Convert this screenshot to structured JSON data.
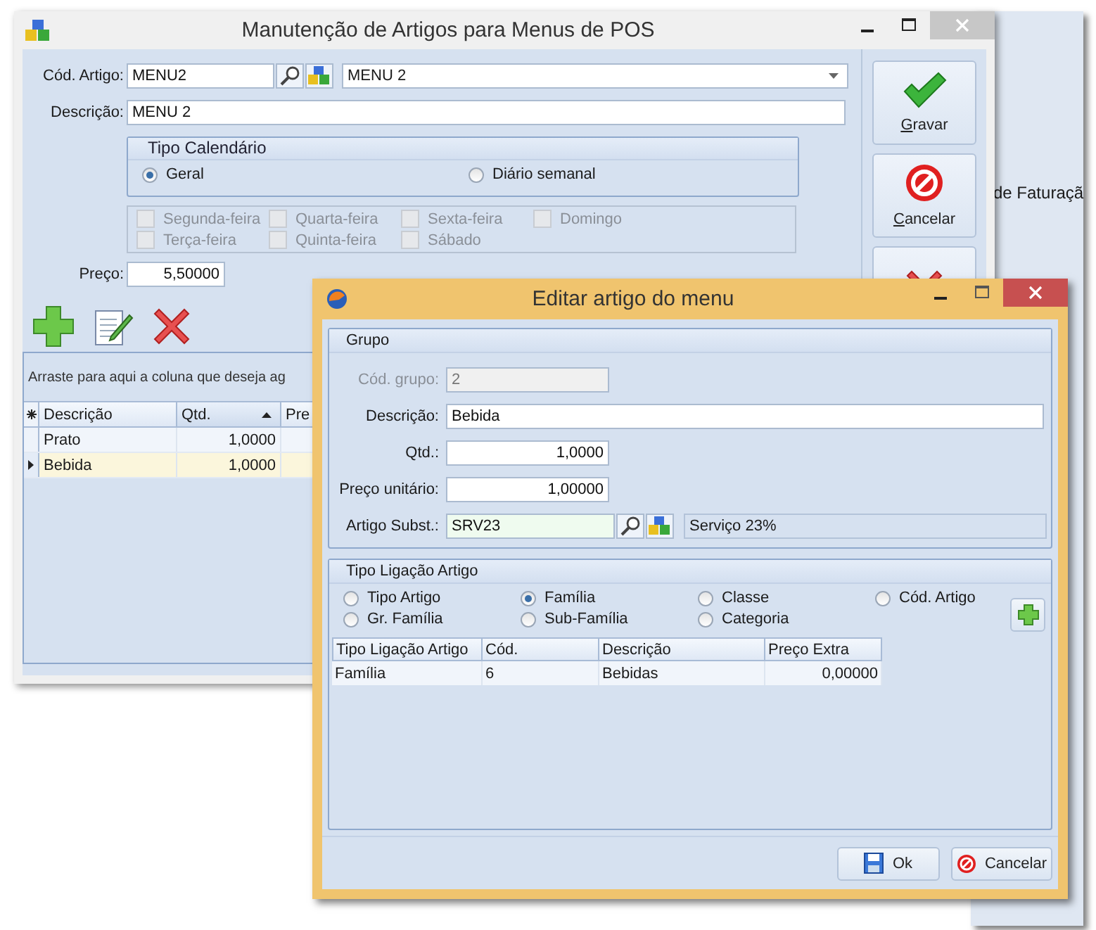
{
  "background_window": {
    "text": "de Faturaçã"
  },
  "main_window": {
    "title": "Manutenção de Artigos para Menus de POS",
    "cod_artigo": {
      "label": "Cód. Artigo:",
      "value": "MENU2",
      "name_value": "MENU 2"
    },
    "descricao": {
      "label": "Descrição:",
      "value": "MENU 2"
    },
    "tipo_calendario": {
      "title": "Tipo Calendário",
      "options": [
        {
          "label": "Geral",
          "selected": true
        },
        {
          "label": "Diário semanal",
          "selected": false
        }
      ]
    },
    "weekdays": [
      {
        "label": "Segunda-feira",
        "checked": false,
        "disabled": true
      },
      {
        "label": "Quarta-feira",
        "checked": false,
        "disabled": true
      },
      {
        "label": "Sexta-feira",
        "checked": false,
        "disabled": true
      },
      {
        "label": "Domingo",
        "checked": false,
        "disabled": true
      },
      {
        "label": "Terça-feira",
        "checked": false,
        "disabled": true
      },
      {
        "label": "Quinta-feira",
        "checked": false,
        "disabled": true
      },
      {
        "label": "Sábado",
        "checked": false,
        "disabled": true
      }
    ],
    "preco": {
      "label": "Preço:",
      "value": "5,50000"
    },
    "toolbar": [
      {
        "kind": "add"
      },
      {
        "kind": "edit"
      },
      {
        "kind": "delete"
      }
    ],
    "grid": {
      "group_hint": "Arraste para aqui a coluna que deseja ag",
      "columns": [
        {
          "label": "Descrição",
          "sorted": false
        },
        {
          "label": "Qtd.",
          "sorted": true
        },
        {
          "label": "Pre",
          "sorted": false
        }
      ],
      "rows": [
        {
          "cells": [
            "Prato",
            "1,0000"
          ],
          "selected": false
        },
        {
          "cells": [
            "Bebida",
            "1,0000"
          ],
          "selected": true
        }
      ]
    },
    "side_buttons": [
      {
        "kind": "save",
        "label": "Gravar"
      },
      {
        "kind": "cancel",
        "label": "Cancelar"
      },
      {
        "kind": "delete"
      }
    ]
  },
  "dialog": {
    "title": "Editar artigo do menu",
    "grupo": {
      "title": "Grupo",
      "fields": [
        {
          "label": "Cód. grupo:",
          "value": "2",
          "disabled": true,
          "kind": "short"
        },
        {
          "label": "Descrição:",
          "value": "Bebida",
          "disabled": false,
          "kind": "wide"
        },
        {
          "label": "Qtd.:",
          "value": "1,0000",
          "disabled": false,
          "kind": "number"
        },
        {
          "label": "Preço unitário:",
          "value": "1,00000",
          "disabled": false,
          "kind": "number"
        },
        {
          "label": "Artigo Subst.:",
          "value": "SRV23",
          "disabled": false,
          "kind": "lookup",
          "description": "Serviço 23%"
        }
      ]
    },
    "tipo_ligacao": {
      "title": "Tipo Ligação Artigo",
      "options": [
        {
          "label": "Tipo Artigo",
          "selected": false
        },
        {
          "label": "Família",
          "selected": true
        },
        {
          "label": "Classe",
          "selected": false
        },
        {
          "label": "Cód. Artigo",
          "selected": false
        },
        {
          "label": "Gr. Família",
          "selected": false
        },
        {
          "label": "Sub-Família",
          "selected": false
        },
        {
          "label": "Categoria",
          "selected": false
        }
      ]
    },
    "table": {
      "columns": [
        "Tipo Ligação Artigo",
        "Cód.",
        "Descrição",
        "Preço Extra"
      ],
      "rows": [
        {
          "cells": [
            "Família",
            "6",
            "Bebidas",
            "0,00000"
          ]
        }
      ]
    },
    "buttons": [
      {
        "kind": "ok",
        "label": "Ok"
      },
      {
        "kind": "cancel",
        "label": "Cancelar"
      }
    ]
  }
}
